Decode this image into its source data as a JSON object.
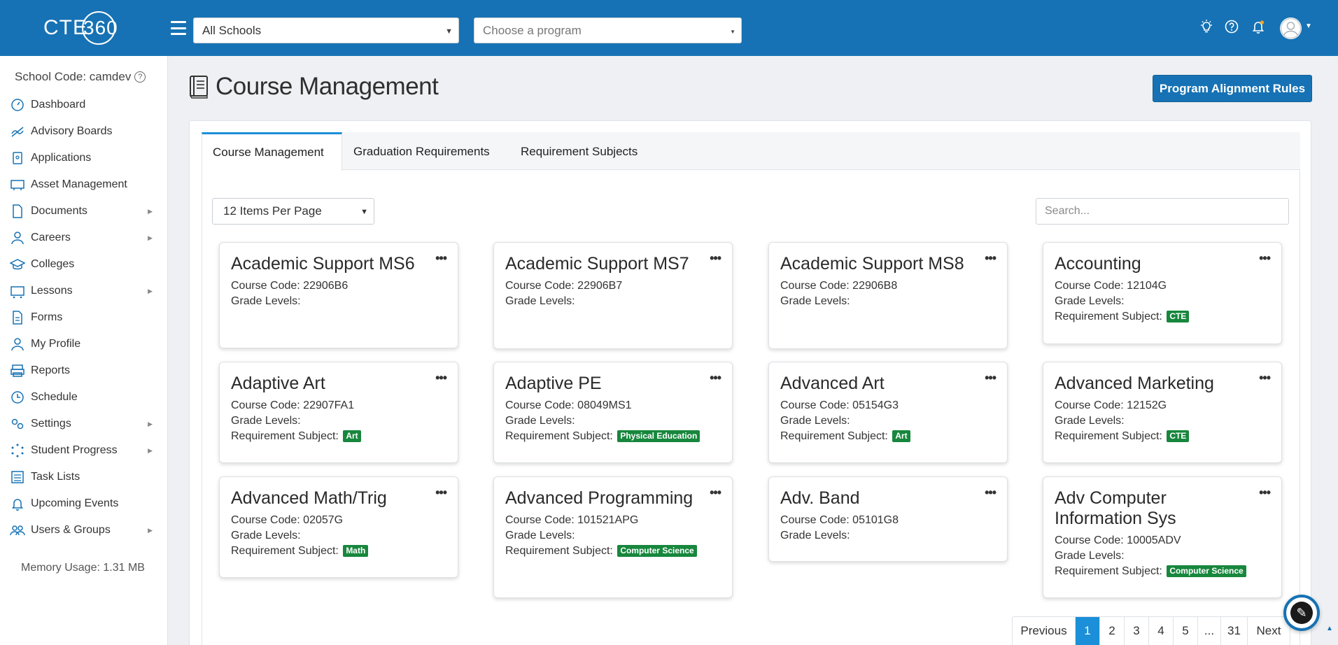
{
  "header": {
    "logo_text": "CTE",
    "logo_number": "360",
    "school_select": "All Schools",
    "program_placeholder": "Choose a program"
  },
  "sidebar": {
    "school_code": "School Code: camdev",
    "items": [
      {
        "label": "Dashboard",
        "icon": "dashboard-icon",
        "has_sub": false
      },
      {
        "label": "Advisory Boards",
        "icon": "advisory-icon",
        "has_sub": false
      },
      {
        "label": "Applications",
        "icon": "applications-icon",
        "has_sub": false
      },
      {
        "label": "Asset Management",
        "icon": "asset-icon",
        "has_sub": false
      },
      {
        "label": "Documents",
        "icon": "documents-icon",
        "has_sub": true
      },
      {
        "label": "Careers",
        "icon": "careers-icon",
        "has_sub": true
      },
      {
        "label": "Colleges",
        "icon": "colleges-icon",
        "has_sub": false
      },
      {
        "label": "Lessons",
        "icon": "lessons-icon",
        "has_sub": true
      },
      {
        "label": "Forms",
        "icon": "forms-icon",
        "has_sub": false
      },
      {
        "label": "My Profile",
        "icon": "profile-icon",
        "has_sub": false
      },
      {
        "label": "Reports",
        "icon": "reports-icon",
        "has_sub": false
      },
      {
        "label": "Schedule",
        "icon": "schedule-icon",
        "has_sub": false
      },
      {
        "label": "Settings",
        "icon": "settings-icon",
        "has_sub": true
      },
      {
        "label": "Student Progress",
        "icon": "progress-icon",
        "has_sub": true
      },
      {
        "label": "Task Lists",
        "icon": "tasklist-icon",
        "has_sub": false
      },
      {
        "label": "Upcoming Events",
        "icon": "events-icon",
        "has_sub": false
      },
      {
        "label": "Users & Groups",
        "icon": "users-icon",
        "has_sub": true
      }
    ],
    "memory": "Memory Usage: 1.31 MB"
  },
  "main": {
    "title": "Course Management",
    "alignment_button": "Program Alignment Rules",
    "tabs": [
      {
        "label": "Course Management",
        "active": true
      },
      {
        "label": "Graduation Requirements",
        "active": false
      },
      {
        "label": "Requirement Subjects",
        "active": false
      }
    ],
    "per_page": "12 Items Per Page",
    "search_placeholder": "Search..."
  },
  "courses": [
    {
      "title": "Academic Support MS6",
      "code": "Course Code: 22906B6",
      "grade": "Grade Levels:",
      "subject_label": "",
      "subject": ""
    },
    {
      "title": "Academic Support MS7",
      "code": "Course Code: 22906B7",
      "grade": "Grade Levels:",
      "subject_label": "",
      "subject": ""
    },
    {
      "title": "Academic Support MS8",
      "code": "Course Code: 22906B8",
      "grade": "Grade Levels:",
      "subject_label": "",
      "subject": ""
    },
    {
      "title": "Accounting",
      "code": "Course Code: 12104G",
      "grade": "Grade Levels:",
      "subject_label": "Requirement Subject:",
      "subject": "CTE"
    },
    {
      "title": "Adaptive Art",
      "code": "Course Code: 22907FA1",
      "grade": "Grade Levels:",
      "subject_label": "Requirement Subject:",
      "subject": "Art"
    },
    {
      "title": "Adaptive PE",
      "code": "Course Code: 08049MS1",
      "grade": "Grade Levels:",
      "subject_label": "Requirement Subject:",
      "subject": "Physical Education"
    },
    {
      "title": "Advanced Art",
      "code": "Course Code: 05154G3",
      "grade": "Grade Levels:",
      "subject_label": "Requirement Subject:",
      "subject": "Art"
    },
    {
      "title": "Advanced Marketing",
      "code": "Course Code: 12152G",
      "grade": "Grade Levels:",
      "subject_label": "Requirement Subject:",
      "subject": "CTE"
    },
    {
      "title": "Advanced Math/Trig",
      "code": "Course Code: 02057G",
      "grade": "Grade Levels:",
      "subject_label": "Requirement Subject:",
      "subject": "Math"
    },
    {
      "title": "Advanced Programming",
      "code": "Course Code: 101521APG",
      "grade": "Grade Levels:",
      "subject_label": "Requirement Subject:",
      "subject": "Computer Science"
    },
    {
      "title": "Adv. Band",
      "code": "Course Code: 05101G8",
      "grade": "Grade Levels:",
      "subject_label": "",
      "subject": ""
    },
    {
      "title": "Adv Computer Information Sys",
      "code": "Course Code: 10005ADV",
      "grade": "Grade Levels:",
      "subject_label": "Requirement Subject:",
      "subject": "Computer Science"
    }
  ],
  "pagination": {
    "prev": "Previous",
    "pages": [
      "1",
      "2",
      "3",
      "4",
      "5",
      "...",
      "31"
    ],
    "active": "1",
    "next": "Next"
  },
  "colors": {
    "brand": "#1672b4",
    "tab_accent": "#1b8fd8",
    "badge": "#17873d"
  }
}
